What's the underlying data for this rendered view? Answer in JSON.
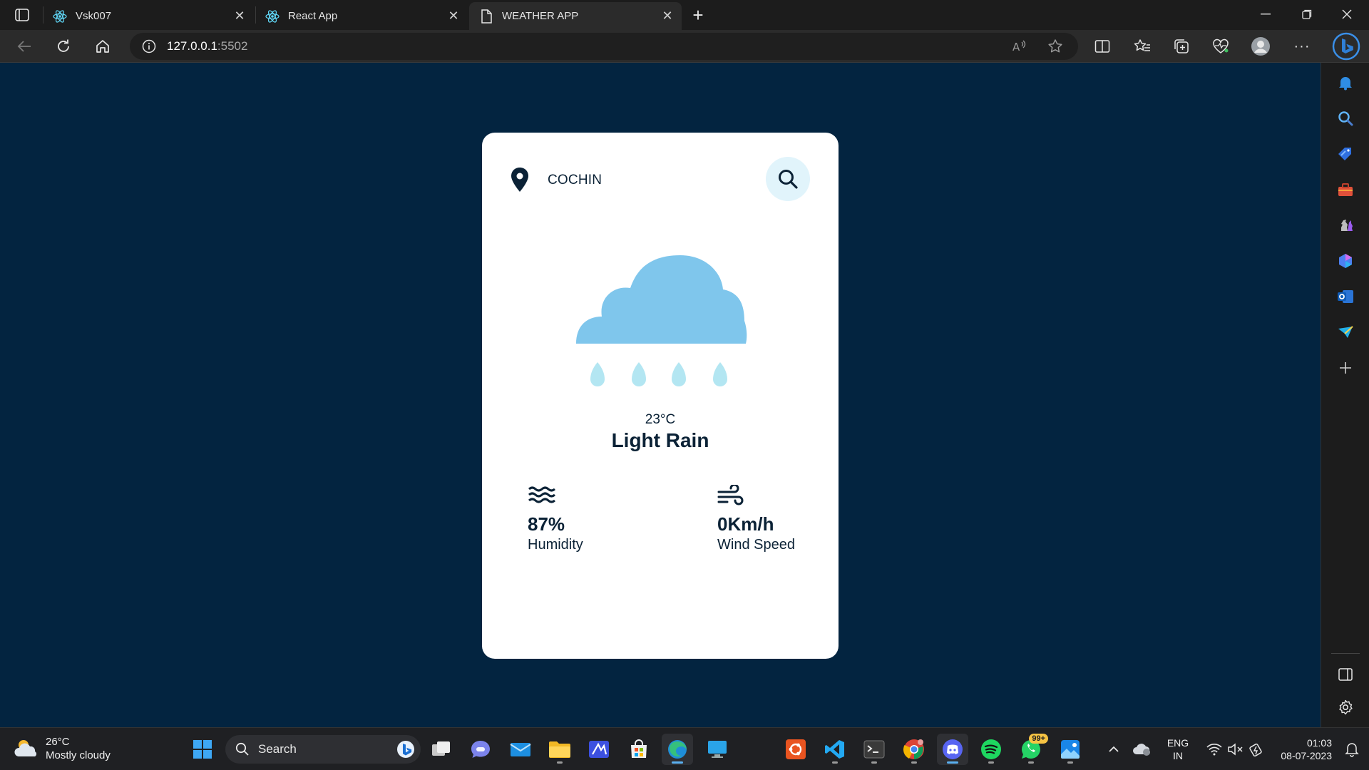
{
  "browser": {
    "tabs": [
      {
        "title": "Vsk007",
        "icon": "react-icon",
        "active": false
      },
      {
        "title": "React App",
        "icon": "react-icon",
        "active": false
      },
      {
        "title": "WEATHER APP",
        "icon": "page-icon",
        "active": true
      }
    ],
    "url_host": "127.0.0.1",
    "url_port": ":5502"
  },
  "weather": {
    "city": "COCHIN",
    "temperature": "23°C",
    "condition": "Light Rain",
    "humidity_value": "87%",
    "humidity_label": "Humidity",
    "wind_value": "0Km/h",
    "wind_label": "Wind Speed"
  },
  "taskbar": {
    "weather_temp": "26°C",
    "weather_desc": "Mostly cloudy",
    "search_label": "Search",
    "whatsapp_badge": "99+",
    "lang_line1": "ENG",
    "lang_line2": "IN",
    "time": "01:03",
    "date": "08-07-2023"
  },
  "colors": {
    "page_bg": "#032440",
    "card_bg": "#ffffff",
    "cloud": "#7fc6ec",
    "raindrop": "#b3e6f2",
    "search_btn_bg": "#e1f4fb",
    "text_dark": "#0b2236"
  }
}
